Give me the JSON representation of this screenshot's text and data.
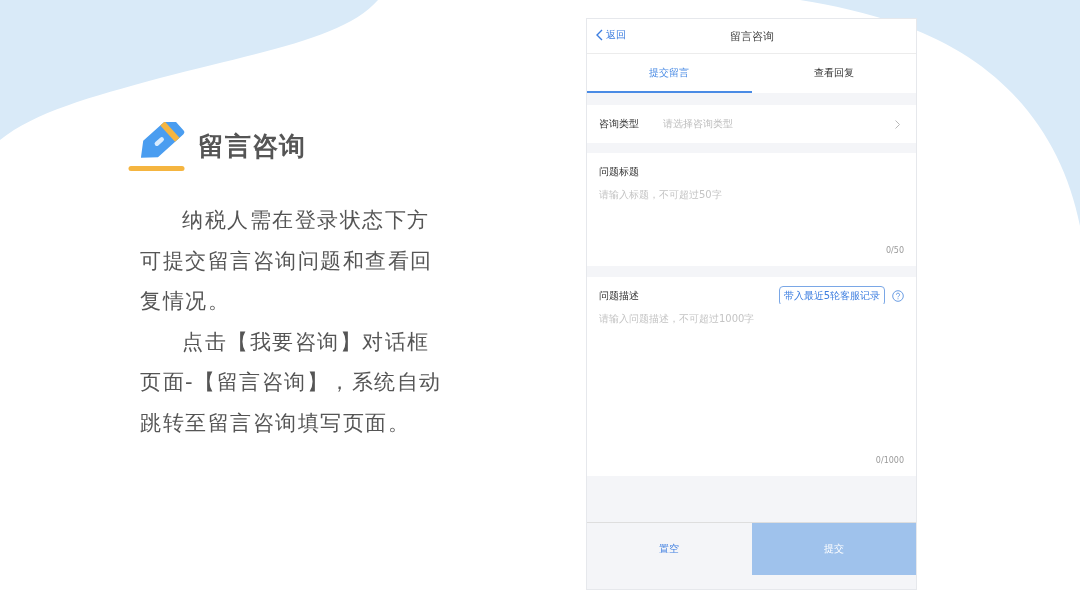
{
  "intro": {
    "title": "留言咨询",
    "paragraphs": [
      "纳税人需在登录状态下方可提交留言咨询问题和查看回复情况。",
      "点击【我要咨询】对话框页面-【留言咨询】，系统自动跳转至留言咨询填写页面。"
    ]
  },
  "phone": {
    "nav_bar": {
      "back": "返回",
      "title": "留言咨询"
    },
    "tabs": [
      {
        "label": "提交留言",
        "selected": true
      },
      {
        "label": "查看回复",
        "selected": false
      }
    ],
    "fields": [
      {
        "kind": "select",
        "label": "咨询类型",
        "placeholder": "请选择咨询类型"
      },
      {
        "kind": "input",
        "label": "问题标题",
        "placeholder": "请输入标题，不可超过50字",
        "counter": "0/50"
      },
      {
        "kind": "textarea",
        "label": "问题描述",
        "placeholder": "请输入问题描述，不可超过1000字",
        "counter": "0/1000",
        "action_button": "带入最近5轮客服记录"
      }
    ],
    "actions": [
      {
        "kind": "secondary",
        "label": "置空",
        "disabled": false
      },
      {
        "kind": "primary",
        "label": "提交",
        "disabled": true
      }
    ]
  }
}
